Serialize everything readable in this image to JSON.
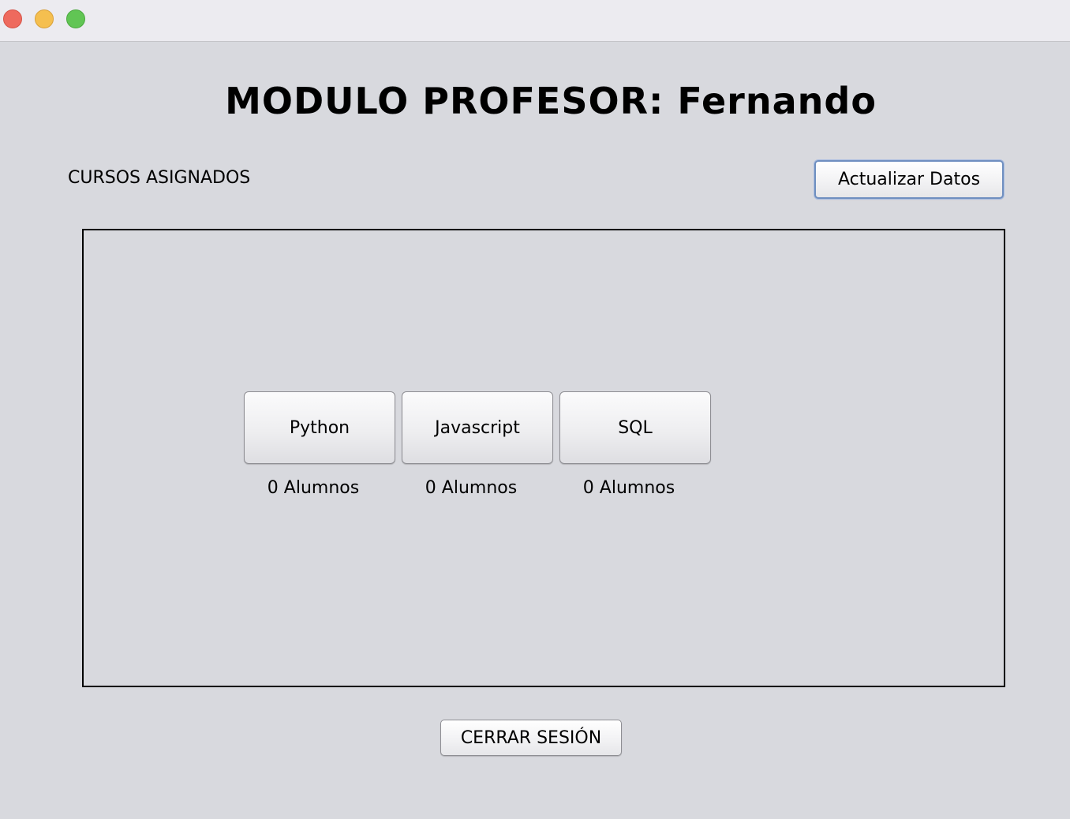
{
  "window": {
    "controls": {
      "close_color": "#ee6a5e",
      "minimize_color": "#f5bf4f",
      "maximize_color": "#61c554"
    }
  },
  "header": {
    "title": "MODULO PROFESOR: Fernando"
  },
  "courses_section": {
    "label": "CURSOS ASIGNADOS",
    "update_button_label": "Actualizar Datos"
  },
  "courses": [
    {
      "name": "Python",
      "students": "0 Alumnos"
    },
    {
      "name": "Javascript",
      "students": "0 Alumnos"
    },
    {
      "name": "SQL",
      "students": "0 Alumnos"
    }
  ],
  "footer": {
    "logout_label": "CERRAR SESIÓN"
  }
}
